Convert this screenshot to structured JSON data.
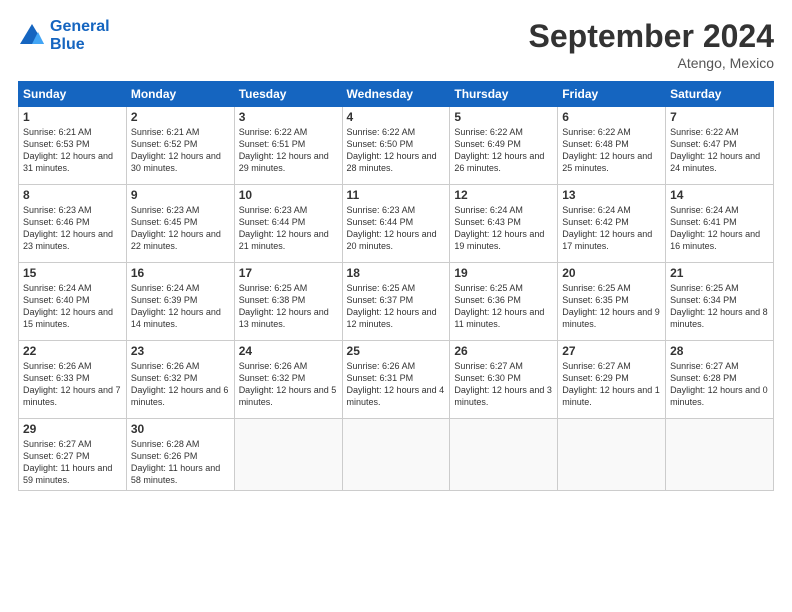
{
  "header": {
    "logo_line1": "General",
    "logo_line2": "Blue",
    "month": "September 2024",
    "location": "Atengo, Mexico"
  },
  "days_of_week": [
    "Sunday",
    "Monday",
    "Tuesday",
    "Wednesday",
    "Thursday",
    "Friday",
    "Saturday"
  ],
  "weeks": [
    [
      {
        "day": 1,
        "sunrise": "6:21 AM",
        "sunset": "6:53 PM",
        "daylight": "12 hours and 31 minutes."
      },
      {
        "day": 2,
        "sunrise": "6:21 AM",
        "sunset": "6:52 PM",
        "daylight": "12 hours and 30 minutes."
      },
      {
        "day": 3,
        "sunrise": "6:22 AM",
        "sunset": "6:51 PM",
        "daylight": "12 hours and 29 minutes."
      },
      {
        "day": 4,
        "sunrise": "6:22 AM",
        "sunset": "6:50 PM",
        "daylight": "12 hours and 28 minutes."
      },
      {
        "day": 5,
        "sunrise": "6:22 AM",
        "sunset": "6:49 PM",
        "daylight": "12 hours and 26 minutes."
      },
      {
        "day": 6,
        "sunrise": "6:22 AM",
        "sunset": "6:48 PM",
        "daylight": "12 hours and 25 minutes."
      },
      {
        "day": 7,
        "sunrise": "6:22 AM",
        "sunset": "6:47 PM",
        "daylight": "12 hours and 24 minutes."
      }
    ],
    [
      {
        "day": 8,
        "sunrise": "6:23 AM",
        "sunset": "6:46 PM",
        "daylight": "12 hours and 23 minutes."
      },
      {
        "day": 9,
        "sunrise": "6:23 AM",
        "sunset": "6:45 PM",
        "daylight": "12 hours and 22 minutes."
      },
      {
        "day": 10,
        "sunrise": "6:23 AM",
        "sunset": "6:44 PM",
        "daylight": "12 hours and 21 minutes."
      },
      {
        "day": 11,
        "sunrise": "6:23 AM",
        "sunset": "6:44 PM",
        "daylight": "12 hours and 20 minutes."
      },
      {
        "day": 12,
        "sunrise": "6:24 AM",
        "sunset": "6:43 PM",
        "daylight": "12 hours and 19 minutes."
      },
      {
        "day": 13,
        "sunrise": "6:24 AM",
        "sunset": "6:42 PM",
        "daylight": "12 hours and 17 minutes."
      },
      {
        "day": 14,
        "sunrise": "6:24 AM",
        "sunset": "6:41 PM",
        "daylight": "12 hours and 16 minutes."
      }
    ],
    [
      {
        "day": 15,
        "sunrise": "6:24 AM",
        "sunset": "6:40 PM",
        "daylight": "12 hours and 15 minutes."
      },
      {
        "day": 16,
        "sunrise": "6:24 AM",
        "sunset": "6:39 PM",
        "daylight": "12 hours and 14 minutes."
      },
      {
        "day": 17,
        "sunrise": "6:25 AM",
        "sunset": "6:38 PM",
        "daylight": "12 hours and 13 minutes."
      },
      {
        "day": 18,
        "sunrise": "6:25 AM",
        "sunset": "6:37 PM",
        "daylight": "12 hours and 12 minutes."
      },
      {
        "day": 19,
        "sunrise": "6:25 AM",
        "sunset": "6:36 PM",
        "daylight": "12 hours and 11 minutes."
      },
      {
        "day": 20,
        "sunrise": "6:25 AM",
        "sunset": "6:35 PM",
        "daylight": "12 hours and 9 minutes."
      },
      {
        "day": 21,
        "sunrise": "6:25 AM",
        "sunset": "6:34 PM",
        "daylight": "12 hours and 8 minutes."
      }
    ],
    [
      {
        "day": 22,
        "sunrise": "6:26 AM",
        "sunset": "6:33 PM",
        "daylight": "12 hours and 7 minutes."
      },
      {
        "day": 23,
        "sunrise": "6:26 AM",
        "sunset": "6:32 PM",
        "daylight": "12 hours and 6 minutes."
      },
      {
        "day": 24,
        "sunrise": "6:26 AM",
        "sunset": "6:32 PM",
        "daylight": "12 hours and 5 minutes."
      },
      {
        "day": 25,
        "sunrise": "6:26 AM",
        "sunset": "6:31 PM",
        "daylight": "12 hours and 4 minutes."
      },
      {
        "day": 26,
        "sunrise": "6:27 AM",
        "sunset": "6:30 PM",
        "daylight": "12 hours and 3 minutes."
      },
      {
        "day": 27,
        "sunrise": "6:27 AM",
        "sunset": "6:29 PM",
        "daylight": "12 hours and 1 minute."
      },
      {
        "day": 28,
        "sunrise": "6:27 AM",
        "sunset": "6:28 PM",
        "daylight": "12 hours and 0 minutes."
      }
    ],
    [
      {
        "day": 29,
        "sunrise": "6:27 AM",
        "sunset": "6:27 PM",
        "daylight": "11 hours and 59 minutes."
      },
      {
        "day": 30,
        "sunrise": "6:28 AM",
        "sunset": "6:26 PM",
        "daylight": "11 hours and 58 minutes."
      },
      null,
      null,
      null,
      null,
      null
    ]
  ]
}
